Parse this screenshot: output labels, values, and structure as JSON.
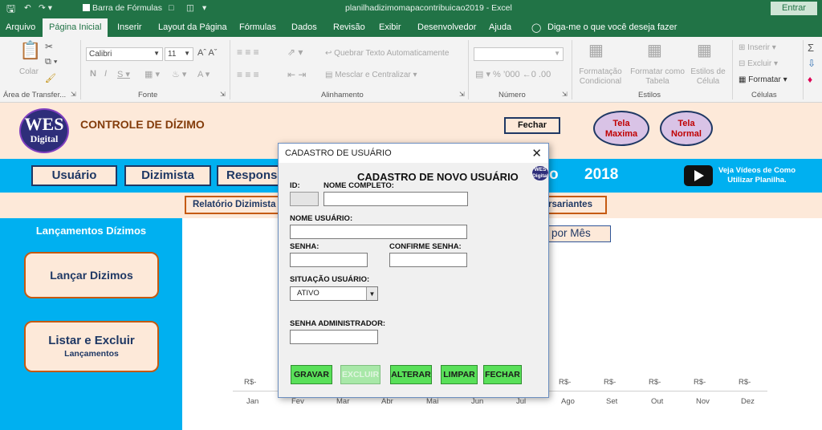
{
  "titlebar": {
    "formula_bar_label": "Barra de Fórmulas",
    "title": "planilhadizimomapacontribuicao2019  -  Excel",
    "signin": "Entrar"
  },
  "menu": {
    "tabs": [
      "Arquivo",
      "Página Inicial",
      "Inserir",
      "Layout da Página",
      "Fórmulas",
      "Dados",
      "Revisão",
      "Exibir",
      "Desenvolvedor",
      "Ajuda"
    ],
    "tell_me": "Diga-me o que você deseja fazer"
  },
  "ribbon": {
    "paste": "Colar",
    "clipboard_group": "Área de Transfer...",
    "font_name": "Calibri",
    "font_size": "11",
    "font_group": "Fonte",
    "wrap_text": "Quebrar Texto Automaticamente",
    "merge_center": "Mesclar e Centralizar",
    "alignment_group": "Alinhamento",
    "number_group": "Número",
    "conditional_formatting": "Formatação Condicional",
    "format_as_table": "Formatar como Tabela",
    "cell_styles": "Estilos de Célula",
    "styles_group": "Estilos",
    "insert": "Inserir",
    "delete": "Excluir",
    "format": "Formatar",
    "cells_group": "Células"
  },
  "sheet": {
    "logo_line1": "WES",
    "logo_line2": "Digital",
    "header_title": "CONTROLE DE DÍZIMO",
    "close_button": "Fechar",
    "max_screen": "Tela Maxima",
    "normal_screen": "Tela Normal",
    "nav_usuario": "Usuário",
    "nav_dizimista": "Dizimista",
    "nav_responsavel": "Responsa",
    "year_prefix": "o",
    "year": "2018",
    "video_text": "Veja Vídeos de Como Utilizar Planilha.",
    "report_dizimista": "Relatório Dizimista",
    "report_aniversariantes": "rsariantes",
    "left_panel_title": "Lançamentos Dízimos",
    "btn_lancar": "Lançar Dizimos",
    "btn_listar": "Listar e Excluir",
    "btn_listar_sub": "Lançamentos",
    "chart_title_fragment": "por Mês",
    "currency_labels": [
      "R$-",
      "R$-",
      "R$-",
      "R$-",
      "R$-",
      "R$-",
      "R$-",
      "R$-",
      "R$-",
      "R$-",
      "R$-",
      "R$-"
    ],
    "months": [
      "Jan",
      "Fev",
      "Mar",
      "Abr",
      "Mai",
      "Jun",
      "Jul",
      "Ago",
      "Set",
      "Out",
      "Nov",
      "Dez"
    ]
  },
  "dialog": {
    "window_title": "CADASTRO DE USUÁRIO",
    "heading": "CADASTRO DE NOVO USUÁRIO",
    "id_label": "ID:",
    "full_name_label": "NOME COMPLETO:",
    "username_label": "NOME USUÁRIO:",
    "password_label": "SENHA:",
    "confirm_label": "CONFIRME SENHA:",
    "status_label": "SITUAÇÃO USUÁRIO:",
    "status_value": "ATIVO",
    "admin_pw_label": "SENHA ADMINISTRADOR:",
    "buttons": {
      "save": "GRAVAR",
      "delete": "EXCLUIR",
      "edit": "ALTERAR",
      "clear": "LIMPAR",
      "close": "FECHAR"
    }
  },
  "colors": {
    "excel_green": "#217346",
    "sheet_blue": "#00b0f0",
    "peach": "#fde9d9",
    "button_green": "#59e059"
  }
}
